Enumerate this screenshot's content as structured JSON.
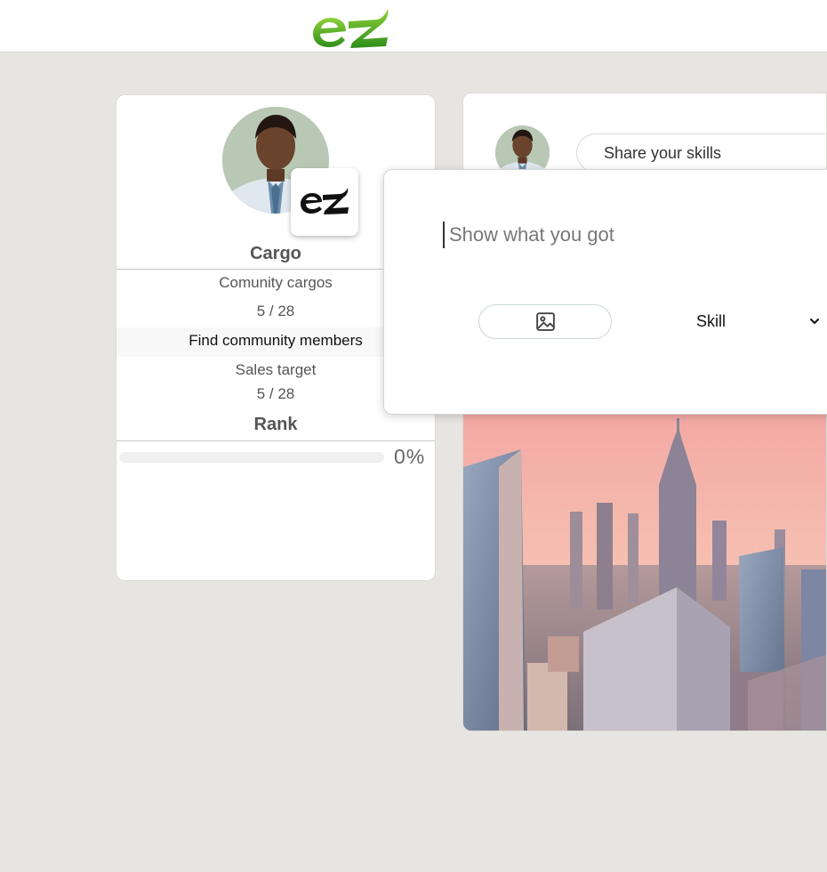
{
  "header": {
    "logo_text": "ez",
    "brand_color": "#4caf1f"
  },
  "profile": {
    "name": "Cargo",
    "community_label": "Comunity cargos",
    "community_value": "5 / 28",
    "find_label": "Find community members",
    "sales_label": "Sales target",
    "sales_value": "5 / 28",
    "rank_label": "Rank",
    "rank_progress": 0,
    "rank_percent_text": "0%",
    "badge_logo_text": "ez"
  },
  "feed": {
    "share_placeholder": "Share your skills",
    "photo_subject": "city-skyline-photo"
  },
  "composer": {
    "placeholder": "Show what you got",
    "image_icon": "image-icon",
    "skill_label": "Skill",
    "dropdown_icon": "chevron-down-icon"
  }
}
